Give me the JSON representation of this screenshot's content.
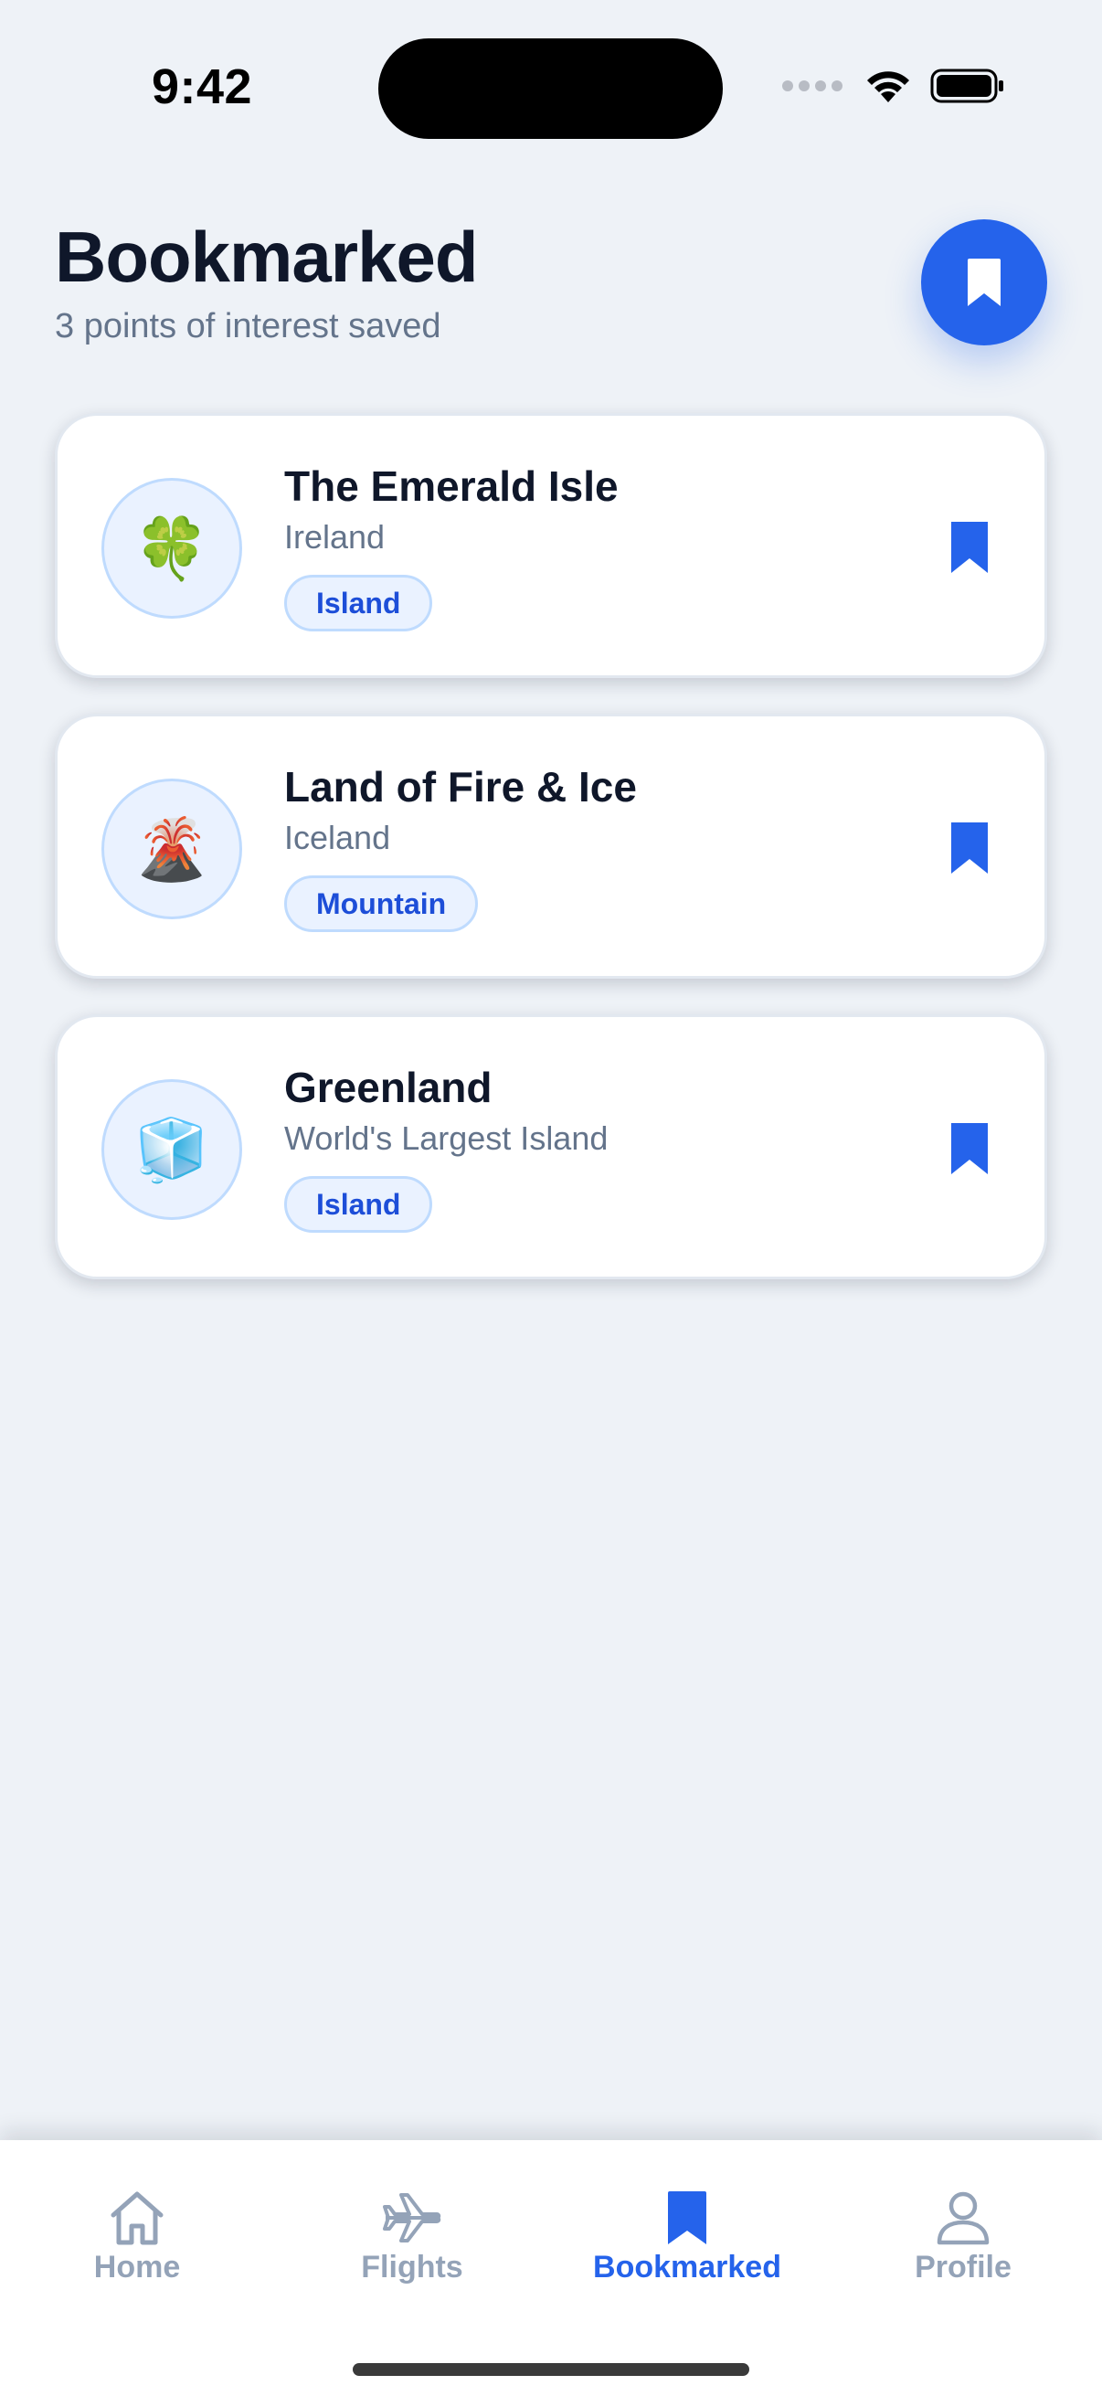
{
  "status_bar": {
    "time": "9:42"
  },
  "header": {
    "title": "Bookmarked",
    "subtitle": "3 points of interest saved"
  },
  "cards": [
    {
      "title": "The Emerald Isle",
      "subtitle": "Ireland",
      "tag": "Island",
      "emoji": "🍀",
      "icon": "shamrock-icon"
    },
    {
      "title": "Land of Fire & Ice",
      "subtitle": "Iceland",
      "tag": "Mountain",
      "emoji": "🌋",
      "icon": "volcano-icon"
    },
    {
      "title": "Greenland",
      "subtitle": "World's Largest Island",
      "tag": "Island",
      "emoji": "🧊",
      "icon": "ice-cube-icon"
    }
  ],
  "tab_bar": {
    "tabs": [
      {
        "label": "Home",
        "icon": "home-icon",
        "active": false
      },
      {
        "label": "Flights",
        "icon": "airplane-icon",
        "active": false
      },
      {
        "label": "Bookmarked",
        "icon": "bookmark-icon",
        "active": true
      },
      {
        "label": "Profile",
        "icon": "person-icon",
        "active": false
      }
    ]
  },
  "colors": {
    "accent": "#2563eb",
    "background": "#eef2f7",
    "text_primary": "#0f172a",
    "text_secondary": "#64748b",
    "tab_inactive": "#94a3b8"
  }
}
